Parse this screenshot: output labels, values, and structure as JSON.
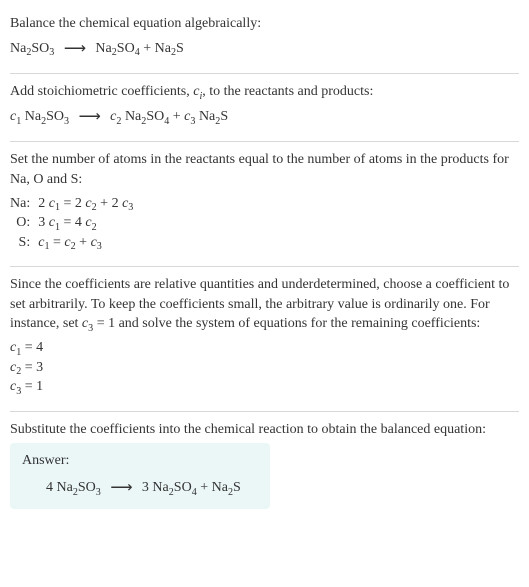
{
  "section1": {
    "instruction": "Balance the chemical equation algebraically:"
  },
  "section2": {
    "instruction_a": "Add stoichiometric coefficients, ",
    "instruction_b": ", to the reactants and products:"
  },
  "section3": {
    "instruction": "Set the number of atoms in the reactants equal to the number of atoms in the products for Na, O and S:",
    "rows": {
      "na_label": "Na:",
      "o_label": "O:",
      "s_label": "S:"
    }
  },
  "section4": {
    "instruction_a": "Since the coefficients are relative quantities and underdetermined, choose a coefficient to set arbitrarily. To keep the coefficients small, the arbitrary value is ordinarily one. For instance, set ",
    "instruction_b": " and solve the system of equations for the remaining coefficients:",
    "c1": "4",
    "c2": "3",
    "c3": "1"
  },
  "section5": {
    "instruction": "Substitute the coefficients into the chemical reaction to obtain the balanced equation:",
    "answer_label": "Answer:"
  },
  "chem": {
    "na2so3": {
      "na": "Na",
      "2a": "2",
      "s": "SO",
      "3": "3"
    },
    "na2so4": {
      "na": "Na",
      "2a": "2",
      "s": "SO",
      "4": "4"
    },
    "na2s": {
      "na": "Na",
      "2a": "2",
      "s": "S"
    }
  },
  "sym": {
    "c": "c",
    "i": "i",
    "one": "1",
    "two": "2",
    "three": "3",
    "four": "4",
    "plus": " + ",
    "eq": " = ",
    "eq2": " = 1",
    "arrow": "⟶"
  },
  "chart_data": {
    "type": "table",
    "title": "Chemical equation balancing",
    "unbalanced_equation": "Na2SO3 -> Na2SO4 + Na2S",
    "elements": [
      "Na",
      "O",
      "S"
    ],
    "atom_balance": [
      {
        "element": "Na",
        "lhs": "2 c1",
        "rhs": "2 c2 + 2 c3"
      },
      {
        "element": "O",
        "lhs": "3 c1",
        "rhs": "4 c2"
      },
      {
        "element": "S",
        "lhs": "c1",
        "rhs": "c2 + c3"
      }
    ],
    "fixed_coefficient": {
      "name": "c3",
      "value": 1
    },
    "solved_coefficients": {
      "c1": 4,
      "c2": 3,
      "c3": 1
    },
    "balanced_equation": "4 Na2SO3 -> 3 Na2SO4 + Na2S"
  }
}
